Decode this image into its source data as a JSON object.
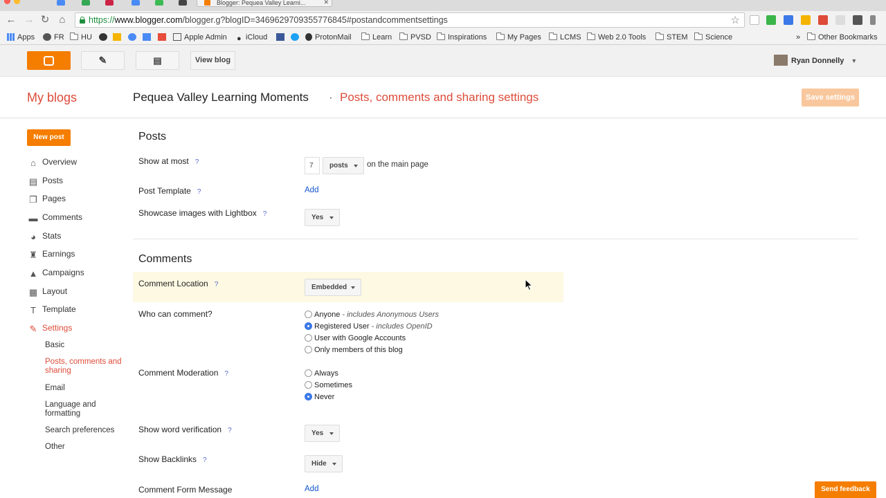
{
  "browser": {
    "tab_title": "Blogger: Pequea Valley Learni...",
    "url_scheme": "https://",
    "url_host": "www.blogger.com",
    "url_path": "/blogger.g?blogID=3469629709355776845#postandcommentsettings"
  },
  "bookmarks": [
    "Apps",
    "FR",
    "HU",
    "Apple Admin",
    "iCloud",
    "ProtonMail",
    "Learn",
    "PVSD",
    "Inspirations",
    "My Pages",
    "LCMS",
    "Web 2.0 Tools",
    "STEM",
    "Science",
    "Other Bookmarks"
  ],
  "blogger_bar": {
    "view_blog": "View blog",
    "user_name": "Ryan Donnelly"
  },
  "header": {
    "my_blogs": "My blogs",
    "blog_title": "Pequea Valley Learning Moments",
    "separator": "·",
    "page_title": "Posts, comments and sharing settings",
    "save_settings": "Save settings"
  },
  "sidebar": {
    "new_post": "New post",
    "items": [
      {
        "label": "Overview",
        "icon": "home-icon"
      },
      {
        "label": "Posts",
        "icon": "posts-icon"
      },
      {
        "label": "Pages",
        "icon": "pages-icon"
      },
      {
        "label": "Comments",
        "icon": "comment-icon"
      },
      {
        "label": "Stats",
        "icon": "pie-chart-icon"
      },
      {
        "label": "Earnings",
        "icon": "trophy-icon"
      },
      {
        "label": "Campaigns",
        "icon": "campaign-icon"
      },
      {
        "label": "Layout",
        "icon": "layout-icon"
      },
      {
        "label": "Template",
        "icon": "template-icon"
      },
      {
        "label": "Settings",
        "icon": "wrench-icon"
      }
    ],
    "settings_sub": [
      "Basic",
      "Posts, comments and sharing",
      "Email",
      "Language and formatting",
      "Search preferences",
      "Other"
    ]
  },
  "posts_section": {
    "title": "Posts",
    "show_at_most_label": "Show at most",
    "show_at_most_value": "7",
    "show_at_most_unit": "posts",
    "show_at_most_suffix": "on the main page",
    "post_template_label": "Post Template",
    "post_template_action": "Add",
    "lightbox_label": "Showcase images with Lightbox",
    "lightbox_value": "Yes"
  },
  "comments_section": {
    "title": "Comments",
    "location_label": "Comment Location",
    "location_value": "Embedded",
    "who_label": "Who can comment?",
    "who_options": [
      {
        "label": "Anyone",
        "note": " - includes Anonymous Users",
        "selected": false
      },
      {
        "label": "Registered User",
        "note": " - includes OpenID",
        "selected": true
      },
      {
        "label": "User with Google Accounts",
        "note": "",
        "selected": false
      },
      {
        "label": "Only members of this blog",
        "note": "",
        "selected": false
      }
    ],
    "moderation_label": "Comment Moderation",
    "moderation_options": [
      {
        "label": "Always",
        "selected": false
      },
      {
        "label": "Sometimes",
        "selected": false
      },
      {
        "label": "Never",
        "selected": true
      }
    ],
    "word_verification_label": "Show word verification",
    "word_verification_value": "Yes",
    "backlinks_label": "Show Backlinks",
    "backlinks_value": "Hide",
    "form_message_label": "Comment Form Message",
    "form_message_action": "Add"
  },
  "help_mark": "?",
  "feedback": "Send feedback",
  "colors": {
    "accent": "#f57d00",
    "title_red": "#dd4b39",
    "link": "#1155cc"
  }
}
